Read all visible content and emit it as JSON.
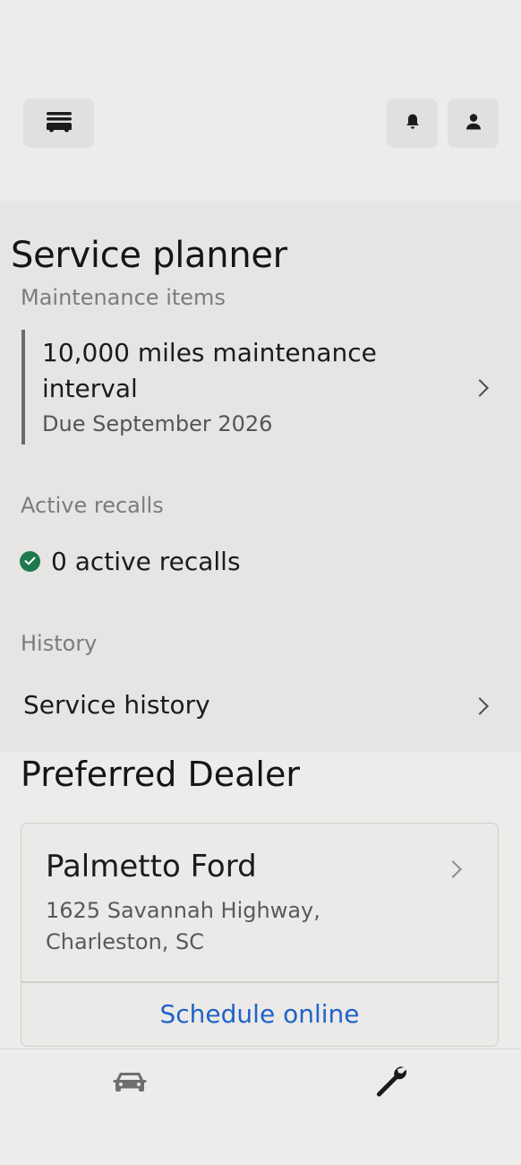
{
  "header": {
    "menu_icon": "vehicle-menu-icon",
    "bell_icon": "bell-icon",
    "user_icon": "user-icon"
  },
  "planner": {
    "title": "Service planner",
    "maintenance_label": "Maintenance items",
    "maintenance_item": {
      "title": "10,000 miles maintenance interval",
      "due": "Due September 2026"
    },
    "recalls_label": "Active recalls",
    "recalls_text": "0 active recalls",
    "history_label": "History",
    "history_link": "Service history"
  },
  "dealer": {
    "heading": "Preferred Dealer",
    "name": "Palmetto Ford",
    "address": "1625 Savannah Highway, Charleston, SC",
    "schedule_label": "Schedule online"
  },
  "bottom_nav": {
    "items": [
      {
        "icon": "car-icon"
      },
      {
        "icon": "wrench-icon"
      }
    ]
  },
  "colors": {
    "accent": "#1f63c9",
    "success": "#1e7a4d",
    "background": "#edecea",
    "panel": "#e6e5e3"
  }
}
